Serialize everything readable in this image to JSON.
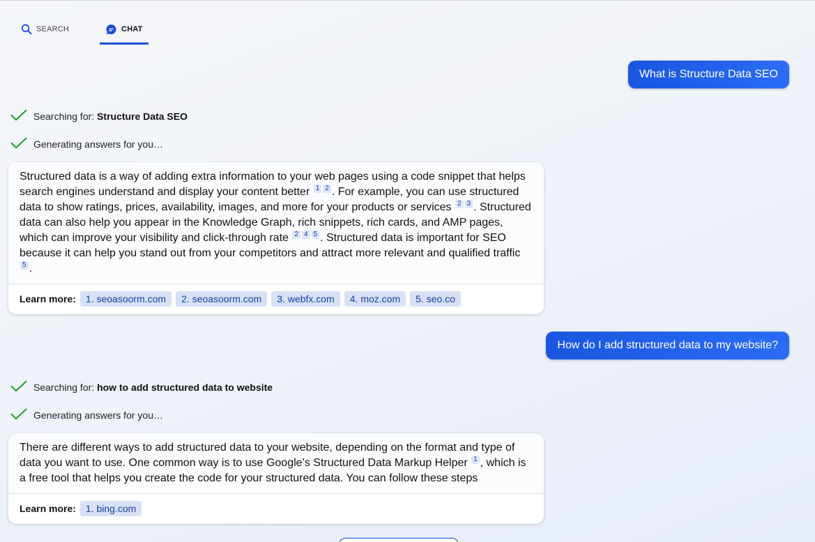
{
  "tabs": {
    "search": {
      "label": "SEARCH",
      "icon": "search-icon"
    },
    "chat": {
      "label": "CHAT",
      "icon": "chat-icon"
    }
  },
  "conversation": [
    {
      "question": "What is Structure Data SEO",
      "status_search_prefix": "Searching for: ",
      "status_search_query": "Structure Data SEO",
      "status_generating": "Generating answers for you…",
      "answer_segments": [
        "Structured data is a way of adding extra information to your web pages using a code snippet that helps search engines understand and display your content better",
        ". For example, you can use structured data to show ratings, prices, availability, images, and more for your products or services",
        ". Structured data can also help you appear in the Knowledge Graph, rich snippets, rich cards, and AMP pages, which can improve your visibility and click-through rate",
        ". Structured data is important for SEO because it can help you stand out from your competitors and attract more relevant and qualified traffic",
        "."
      ],
      "citations": [
        [
          "1",
          "2"
        ],
        [
          "2",
          "3"
        ],
        [
          "2",
          "4",
          "5"
        ],
        [
          "5"
        ]
      ],
      "learn_more_label": "Learn more:",
      "sources": [
        "1. seoasoorm.com",
        "2. seoasoorm.com",
        "3. webfx.com",
        "4. moz.com",
        "5. seo.co"
      ]
    },
    {
      "question": "How do I add structured data to my website?",
      "status_search_prefix": "Searching for: ",
      "status_search_query": "how to add structured data to website",
      "status_generating": "Generating answers for you…",
      "answer_segments": [
        "There are different ways to add structured data to your website, depending on the format and type of data you want to use. One common way is to use Google’s Structured Data Markup Helper",
        ", which is a free tool that helps you create the code for your structured data. You can follow these steps"
      ],
      "citations": [
        [
          "1"
        ]
      ],
      "learn_more_label": "Learn more:",
      "sources": [
        "1. bing.com"
      ]
    }
  ],
  "colors": {
    "accent": "#1a4fd6",
    "check": "#1a9e2f",
    "source_chip_bg": "#d7e1f6"
  }
}
